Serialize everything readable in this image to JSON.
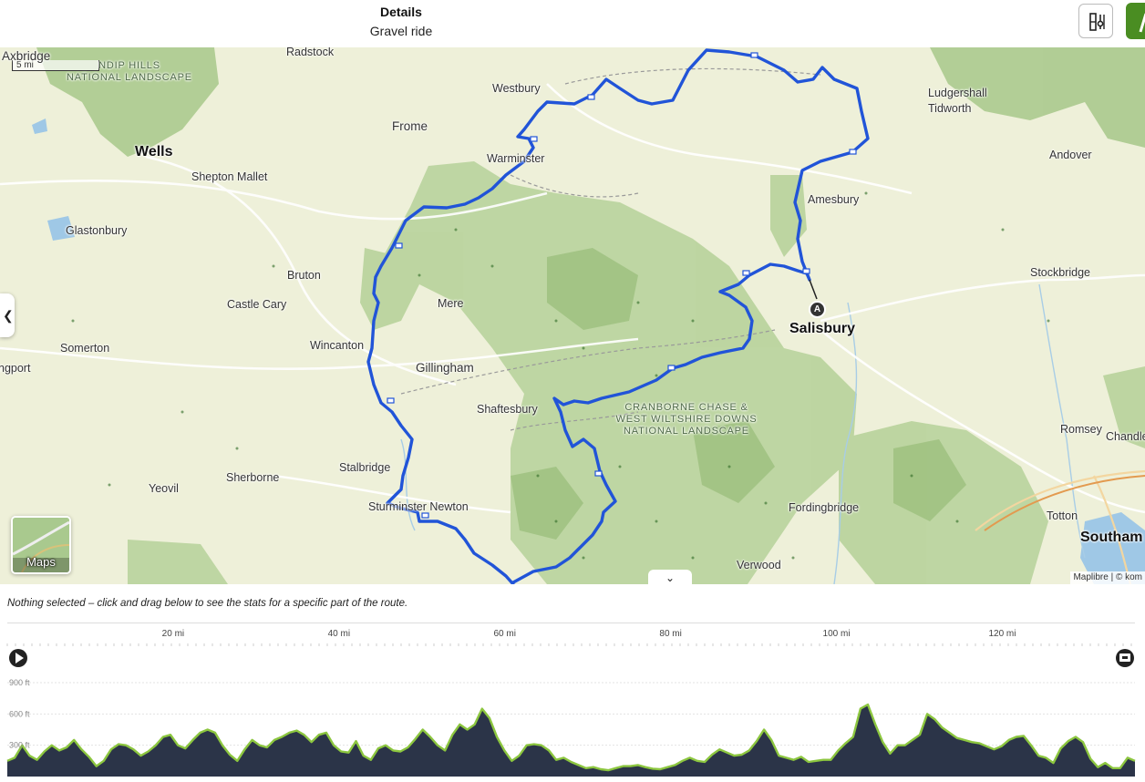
{
  "header": {
    "title": "Details",
    "subtitle": "Gravel ride"
  },
  "map": {
    "scale_label": "5 mi",
    "attribution": "Maplibre | © kom",
    "layer_button_label": "Maps",
    "start_marker_label": "A",
    "route_color": "#2154d8",
    "places": [
      {
        "name": "Axbridge",
        "style": "mid"
      },
      {
        "name": "Radstock",
        "style": "small"
      },
      {
        "name": "Westbury",
        "style": "small"
      },
      {
        "name": "Ludgershall",
        "style": "small"
      },
      {
        "name": "Tidworth",
        "style": "small"
      },
      {
        "name": "Frome",
        "style": "mid"
      },
      {
        "name": "Wells",
        "style": "big"
      },
      {
        "name": "Shepton Mallet",
        "style": "small"
      },
      {
        "name": "Warminster",
        "style": "small"
      },
      {
        "name": "Andover",
        "style": "small"
      },
      {
        "name": "Amesbury",
        "style": "small"
      },
      {
        "name": "Glastonbury",
        "style": "small"
      },
      {
        "name": "Bruton",
        "style": "small"
      },
      {
        "name": "Stockbridge",
        "style": "small"
      },
      {
        "name": "Castle Cary",
        "style": "small"
      },
      {
        "name": "Mere",
        "style": "small"
      },
      {
        "name": "Salisbury",
        "style": "big"
      },
      {
        "name": "Somerton",
        "style": "small"
      },
      {
        "name": "Wincanton",
        "style": "small"
      },
      {
        "name": "ngport",
        "style": "small"
      },
      {
        "name": "Gillingham",
        "style": "mid"
      },
      {
        "name": "Shaftesbury",
        "style": "small"
      },
      {
        "name": "Romsey",
        "style": "small"
      },
      {
        "name": "Chandle",
        "style": "small"
      },
      {
        "name": "Stalbridge",
        "style": "small"
      },
      {
        "name": "Yeovil",
        "style": "small"
      },
      {
        "name": "Sherborne",
        "style": "small"
      },
      {
        "name": "Fordingbridge",
        "style": "small"
      },
      {
        "name": "Sturminster Newton",
        "style": "small"
      },
      {
        "name": "Totton",
        "style": "small"
      },
      {
        "name": "Southam",
        "style": "big"
      },
      {
        "name": "Verwood",
        "style": "small"
      }
    ],
    "parks": [
      {
        "lines": [
          "NDIP HILLS",
          "NATIONAL LANDSCAPE"
        ]
      },
      {
        "lines": [
          "CRANBORNE CHASE &",
          "WEST WILTSHIRE DOWNS",
          "NATIONAL LANDSCAPE"
        ]
      }
    ]
  },
  "stats_note": "Nothing selected – click and drag below to see the stats for a specific part of the route.",
  "elevation": {
    "distance_ticks": [
      "20 mi",
      "40 mi",
      "60 mi",
      "80 mi",
      "100 mi",
      "120 mi"
    ],
    "distance_tick_values": [
      20,
      40,
      60,
      80,
      100,
      120
    ],
    "total_distance_mi": 136,
    "y_ticks": [
      "900 ft",
      "600 ft",
      "300 ft"
    ],
    "y_tick_values": [
      900,
      600,
      300
    ],
    "profile_ft": [
      150,
      180,
      300,
      200,
      160,
      240,
      300,
      250,
      280,
      350,
      260,
      190,
      100,
      150,
      260,
      310,
      300,
      260,
      200,
      240,
      300,
      380,
      400,
      300,
      270,
      350,
      420,
      450,
      420,
      300,
      210,
      150,
      260,
      350,
      300,
      280,
      350,
      380,
      420,
      440,
      400,
      330,
      400,
      420,
      300,
      240,
      230,
      340,
      200,
      160,
      270,
      300,
      250,
      240,
      280,
      360,
      450,
      380,
      300,
      250,
      400,
      500,
      450,
      500,
      650,
      560,
      380,
      250,
      150,
      200,
      300,
      310,
      300,
      250,
      160,
      180,
      140,
      110,
      80,
      90,
      70,
      60,
      80,
      100,
      100,
      110,
      90,
      75,
      70,
      90,
      110,
      150,
      180,
      150,
      140,
      210,
      260,
      230,
      200,
      210,
      250,
      340,
      450,
      350,
      200,
      180,
      160,
      190,
      140,
      150,
      160,
      160,
      250,
      320,
      380,
      650,
      690,
      500,
      330,
      220,
      300,
      300,
      350,
      400,
      600,
      550,
      470,
      420,
      370,
      350,
      330,
      320,
      290,
      260,
      290,
      350,
      380,
      390,
      300,
      200,
      180,
      130,
      270,
      340,
      380,
      330,
      170,
      90,
      130,
      80,
      80,
      180,
      150
    ],
    "chart_colors": {
      "fill": "#2b3448",
      "line": "#8cc63f"
    }
  }
}
